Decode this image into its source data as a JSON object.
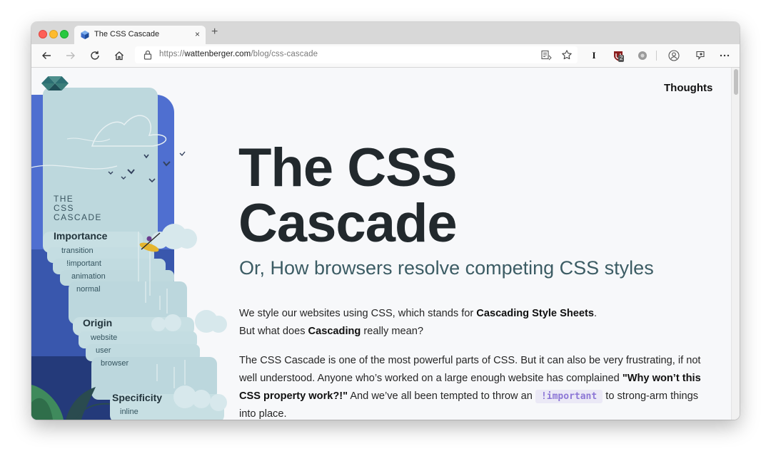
{
  "tab": {
    "title": "The CSS Cascade",
    "close": "×",
    "new_tab": "+"
  },
  "address": {
    "protocol": "https://",
    "host": "wattenberger.com",
    "path": "/blog/css-cascade"
  },
  "toolbar": {
    "ext_badge": "2",
    "profile": "I"
  },
  "nav": {
    "thoughts": "Thoughts"
  },
  "hero": {
    "title_line1": "The CSS",
    "title_line2": "Cascade",
    "subtitle": "Or, How browsers resolve competing CSS styles"
  },
  "intro": {
    "p1_a": "We style our websites using CSS, which stands for ",
    "p1_b": "Cascading Style Sheets",
    "p1_c": ".",
    "p2_a": "But what does ",
    "p2_b": "Cascading",
    "p2_c": " really mean?",
    "p3_a": "The CSS Cascade is one of the most powerful parts of CSS. But it can also be very frustrating, if not well understood. Anyone who’s worked on a large enough website has complained ",
    "p3_b": "\"Why won’t this CSS property work?!\"",
    "p3_c": " And we’ve all been tempted to throw an ",
    "p3_code": "!important",
    "p3_d": " to strong-arm things into place."
  },
  "illustration": {
    "title": [
      "THE",
      "CSS",
      "CASCADE"
    ],
    "importance": {
      "heading": "Importance",
      "items": [
        "transition",
        "!important",
        "animation",
        "normal"
      ]
    },
    "origin": {
      "heading": "Origin",
      "items": [
        "website",
        "user",
        "browser"
      ]
    },
    "specificity": {
      "heading": "Specificity",
      "items": [
        "inline"
      ]
    }
  },
  "colors": {
    "accent": "#8d77d6",
    "title": "#22292d",
    "subtitle": "#3c5c64",
    "sky": "#b9d6dc",
    "blue": "#4a67c9"
  }
}
